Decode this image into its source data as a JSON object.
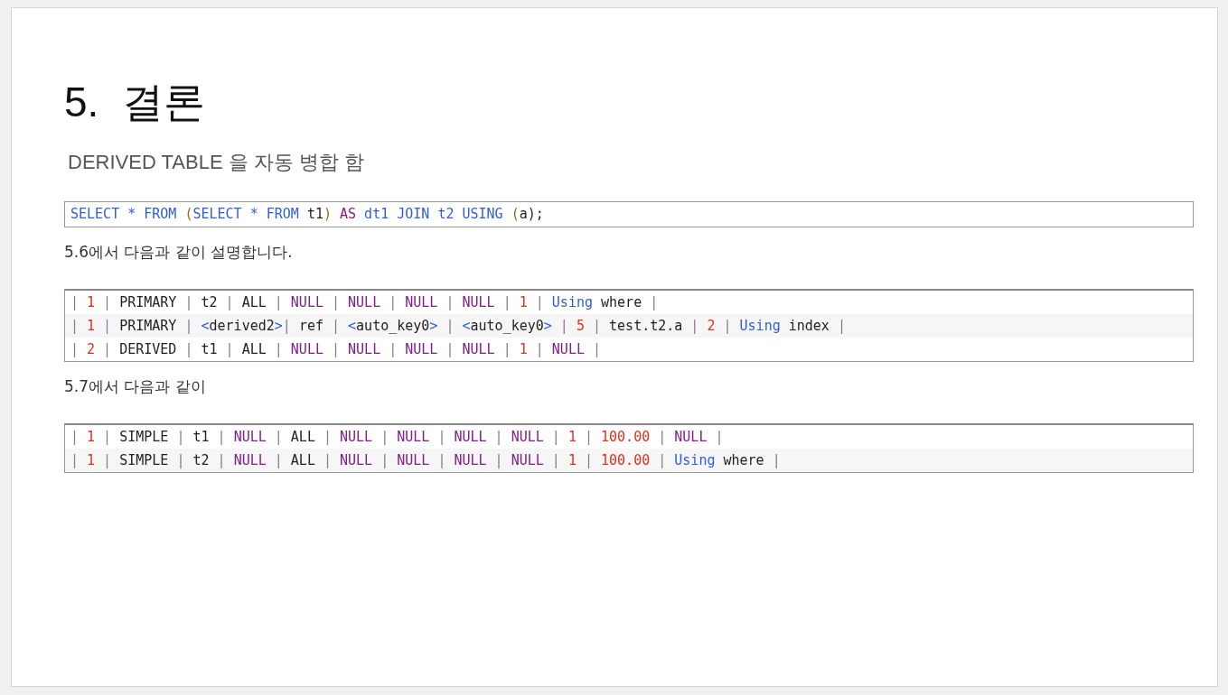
{
  "slide": {
    "title": "5.  결론",
    "subtitle": "DERIVED TABLE 을 자동 병합 함",
    "sections": [
      {
        "code": [
          [
            {
              "text": "SELECT * FROM ",
              "kind": "kw"
            },
            {
              "text": "(",
              "kind": "paren"
            },
            {
              "text": "SELECT * FROM ",
              "kind": "kw"
            },
            {
              "text": "t1",
              "kind": "txt"
            },
            {
              "text": ")",
              "kind": "paren"
            },
            {
              "text": " AS",
              "kind": "as"
            },
            {
              "text": " dt1 JOIN t2 USING ",
              "kind": "kw"
            },
            {
              "text": "(",
              "kind": "paren"
            },
            {
              "text": "a",
              "kind": "txt"
            },
            {
              "text": ");",
              "kind": "txt"
            }
          ]
        ]
      },
      {
        "caption": "5.6에서 다음과 같이 설명합니다.",
        "code": [
          [
            {
              "text": "| ",
              "kind": "pipe"
            },
            {
              "text": "1",
              "kind": "num"
            },
            {
              "text": " | ",
              "kind": "pipe"
            },
            {
              "text": "PRIMARY",
              "kind": "txt"
            },
            {
              "text": " | ",
              "kind": "pipe"
            },
            {
              "text": "t2",
              "kind": "txt"
            },
            {
              "text": " | ",
              "kind": "pipe"
            },
            {
              "text": "ALL",
              "kind": "txt"
            },
            {
              "text": " | ",
              "kind": "pipe"
            },
            {
              "text": "NULL",
              "kind": "null"
            },
            {
              "text": " | ",
              "kind": "pipe"
            },
            {
              "text": "NULL",
              "kind": "null"
            },
            {
              "text": " | ",
              "kind": "pipe"
            },
            {
              "text": "NULL",
              "kind": "null"
            },
            {
              "text": " | ",
              "kind": "pipe"
            },
            {
              "text": "NULL",
              "kind": "null"
            },
            {
              "text": " | ",
              "kind": "pipe"
            },
            {
              "text": "1",
              "kind": "num"
            },
            {
              "text": " | ",
              "kind": "pipe"
            },
            {
              "text": "Using",
              "kind": "kw"
            },
            {
              "text": " where",
              "kind": "txt"
            },
            {
              "text": " |",
              "kind": "pipe"
            }
          ],
          [
            {
              "text": "| ",
              "kind": "pipe"
            },
            {
              "text": "1",
              "kind": "num"
            },
            {
              "text": " | ",
              "kind": "pipe"
            },
            {
              "text": "PRIMARY",
              "kind": "txt"
            },
            {
              "text": " | ",
              "kind": "pipe"
            },
            {
              "text": "<",
              "kind": "kw"
            },
            {
              "text": "derived2",
              "kind": "txt"
            },
            {
              "text": ">",
              "kind": "kw"
            },
            {
              "text": "| ",
              "kind": "pipe"
            },
            {
              "text": "ref",
              "kind": "txt"
            },
            {
              "text": " | ",
              "kind": "pipe"
            },
            {
              "text": "<",
              "kind": "kw"
            },
            {
              "text": "auto_key0",
              "kind": "txt"
            },
            {
              "text": ">",
              "kind": "kw"
            },
            {
              "text": " | ",
              "kind": "pipe"
            },
            {
              "text": "<",
              "kind": "kw"
            },
            {
              "text": "auto_key0",
              "kind": "txt"
            },
            {
              "text": ">",
              "kind": "kw"
            },
            {
              "text": " | ",
              "kind": "pipe"
            },
            {
              "text": "5",
              "kind": "num"
            },
            {
              "text": " | ",
              "kind": "pipe"
            },
            {
              "text": "test.t2.a",
              "kind": "txt"
            },
            {
              "text": " | ",
              "kind": "pipe"
            },
            {
              "text": "2",
              "kind": "num"
            },
            {
              "text": " | ",
              "kind": "pipe"
            },
            {
              "text": "Using",
              "kind": "kw"
            },
            {
              "text": " index",
              "kind": "txt"
            },
            {
              "text": " |",
              "kind": "pipe"
            }
          ],
          [
            {
              "text": "| ",
              "kind": "pipe"
            },
            {
              "text": "2",
              "kind": "num"
            },
            {
              "text": " | ",
              "kind": "pipe"
            },
            {
              "text": "DERIVED",
              "kind": "txt"
            },
            {
              "text": " | ",
              "kind": "pipe"
            },
            {
              "text": "t1",
              "kind": "txt"
            },
            {
              "text": " | ",
              "kind": "pipe"
            },
            {
              "text": "ALL",
              "kind": "txt"
            },
            {
              "text": " | ",
              "kind": "pipe"
            },
            {
              "text": "NULL",
              "kind": "null"
            },
            {
              "text": " | ",
              "kind": "pipe"
            },
            {
              "text": "NULL",
              "kind": "null"
            },
            {
              "text": " | ",
              "kind": "pipe"
            },
            {
              "text": "NULL",
              "kind": "null"
            },
            {
              "text": " | ",
              "kind": "pipe"
            },
            {
              "text": "NULL",
              "kind": "null"
            },
            {
              "text": " | ",
              "kind": "pipe"
            },
            {
              "text": "1",
              "kind": "num"
            },
            {
              "text": " | ",
              "kind": "pipe"
            },
            {
              "text": "NULL",
              "kind": "null"
            },
            {
              "text": " |",
              "kind": "pipe"
            }
          ]
        ]
      },
      {
        "caption": "5.7에서 다음과 같이",
        "code": [
          [
            {
              "text": "| ",
              "kind": "pipe"
            },
            {
              "text": "1",
              "kind": "num"
            },
            {
              "text": " | ",
              "kind": "pipe"
            },
            {
              "text": "SIMPLE",
              "kind": "txt"
            },
            {
              "text": " | ",
              "kind": "pipe"
            },
            {
              "text": "t1",
              "kind": "txt"
            },
            {
              "text": " | ",
              "kind": "pipe"
            },
            {
              "text": "NULL",
              "kind": "null"
            },
            {
              "text": " | ",
              "kind": "pipe"
            },
            {
              "text": "ALL",
              "kind": "txt"
            },
            {
              "text": " | ",
              "kind": "pipe"
            },
            {
              "text": "NULL",
              "kind": "null"
            },
            {
              "text": " | ",
              "kind": "pipe"
            },
            {
              "text": "NULL",
              "kind": "null"
            },
            {
              "text": " | ",
              "kind": "pipe"
            },
            {
              "text": "NULL",
              "kind": "null"
            },
            {
              "text": " | ",
              "kind": "pipe"
            },
            {
              "text": "NULL",
              "kind": "null"
            },
            {
              "text": " | ",
              "kind": "pipe"
            },
            {
              "text": "1",
              "kind": "num"
            },
            {
              "text": " | ",
              "kind": "pipe"
            },
            {
              "text": "100.00",
              "kind": "num"
            },
            {
              "text": " | ",
              "kind": "pipe"
            },
            {
              "text": "NULL",
              "kind": "null"
            },
            {
              "text": " |",
              "kind": "pipe"
            }
          ],
          [
            {
              "text": "| ",
              "kind": "pipe"
            },
            {
              "text": "1",
              "kind": "num"
            },
            {
              "text": " | ",
              "kind": "pipe"
            },
            {
              "text": "SIMPLE",
              "kind": "txt"
            },
            {
              "text": " | ",
              "kind": "pipe"
            },
            {
              "text": "t2",
              "kind": "txt"
            },
            {
              "text": " | ",
              "kind": "pipe"
            },
            {
              "text": "NULL",
              "kind": "null"
            },
            {
              "text": " | ",
              "kind": "pipe"
            },
            {
              "text": "ALL",
              "kind": "txt"
            },
            {
              "text": " | ",
              "kind": "pipe"
            },
            {
              "text": "NULL",
              "kind": "null"
            },
            {
              "text": " | ",
              "kind": "pipe"
            },
            {
              "text": "NULL",
              "kind": "null"
            },
            {
              "text": " | ",
              "kind": "pipe"
            },
            {
              "text": "NULL",
              "kind": "null"
            },
            {
              "text": " | ",
              "kind": "pipe"
            },
            {
              "text": "NULL",
              "kind": "null"
            },
            {
              "text": " | ",
              "kind": "pipe"
            },
            {
              "text": "1",
              "kind": "num"
            },
            {
              "text": " | ",
              "kind": "pipe"
            },
            {
              "text": "100.00",
              "kind": "num"
            },
            {
              "text": " | ",
              "kind": "pipe"
            },
            {
              "text": "Using",
              "kind": "kw"
            },
            {
              "text": " where",
              "kind": "txt"
            },
            {
              "text": " |",
              "kind": "pipe"
            }
          ]
        ]
      }
    ]
  }
}
